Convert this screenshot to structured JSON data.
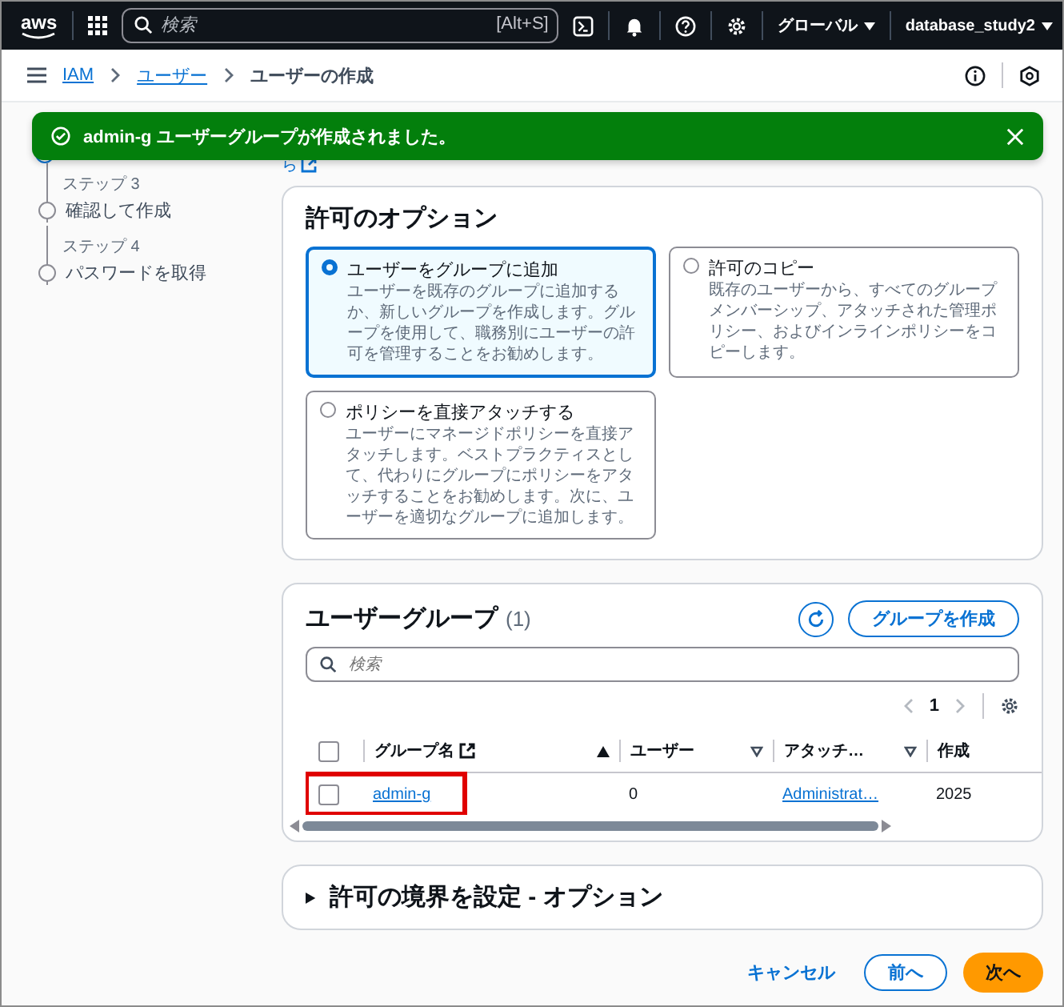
{
  "topbar": {
    "logo": "aws",
    "search_placeholder": "検索",
    "shortcut": "[Alt+S]",
    "region": "グローバル",
    "account": "database_study2"
  },
  "breadcrumb": [
    {
      "label": "IAM",
      "link": true
    },
    {
      "label": "ユーザー",
      "link": true
    },
    {
      "label": "ユーザーの作成",
      "link": false
    }
  ],
  "toast": {
    "kind": "success",
    "message": "admin-g ユーザーグループが作成されました。"
  },
  "hidden_link_fragment": "ら",
  "steps": [
    {
      "label": "ステップ 3",
      "title": "確認して作成"
    },
    {
      "label": "ステップ 4",
      "title": "パスワードを取得"
    }
  ],
  "permission_options": {
    "title": "許可のオプション",
    "options": [
      {
        "title": "ユーザーをグループに追加",
        "description": "ユーザーを既存のグループに追加するか、新しいグループを作成します。グループを使用して、職務別にユーザーの許可を管理することをお勧めします。",
        "selected": true
      },
      {
        "title": "許可のコピー",
        "description": "既存のユーザーから、すべてのグループメンバーシップ、アタッチされた管理ポリシー、およびインラインポリシーをコピーします。",
        "selected": false
      },
      {
        "title": "ポリシーを直接アタッチする",
        "description": "ユーザーにマネージドポリシーを直接アタッチします。ベストプラクティスとして、代わりにグループにポリシーをアタッチすることをお勧めします。次に、ユーザーを適切なグループに追加します。",
        "selected": false
      }
    ]
  },
  "user_groups": {
    "title": "ユーザーグループ",
    "count": "(1)",
    "create_button": "グループを作成",
    "search_placeholder": "検索",
    "page": "1",
    "all_selected": false,
    "columns": [
      {
        "label": "グループ名",
        "sorted": true,
        "external_link": true
      },
      {
        "label": "ユーザー",
        "sorted": false
      },
      {
        "label": "アタッチ…",
        "sorted": false
      },
      {
        "label": "作成"
      }
    ],
    "rows": [
      {
        "selected": false,
        "highlighted": true,
        "cells": [
          {
            "kind": "link",
            "text": "admin-g"
          },
          {
            "kind": "text",
            "text": "0"
          },
          {
            "kind": "link",
            "text": "Administrat…"
          },
          {
            "kind": "text",
            "text": "2025"
          }
        ]
      }
    ]
  },
  "boundary": {
    "title": "許可の境界を設定 - オプション",
    "expanded": false
  },
  "footer": {
    "cancel": "キャンセル",
    "previous": "前へ",
    "next": "次へ"
  }
}
